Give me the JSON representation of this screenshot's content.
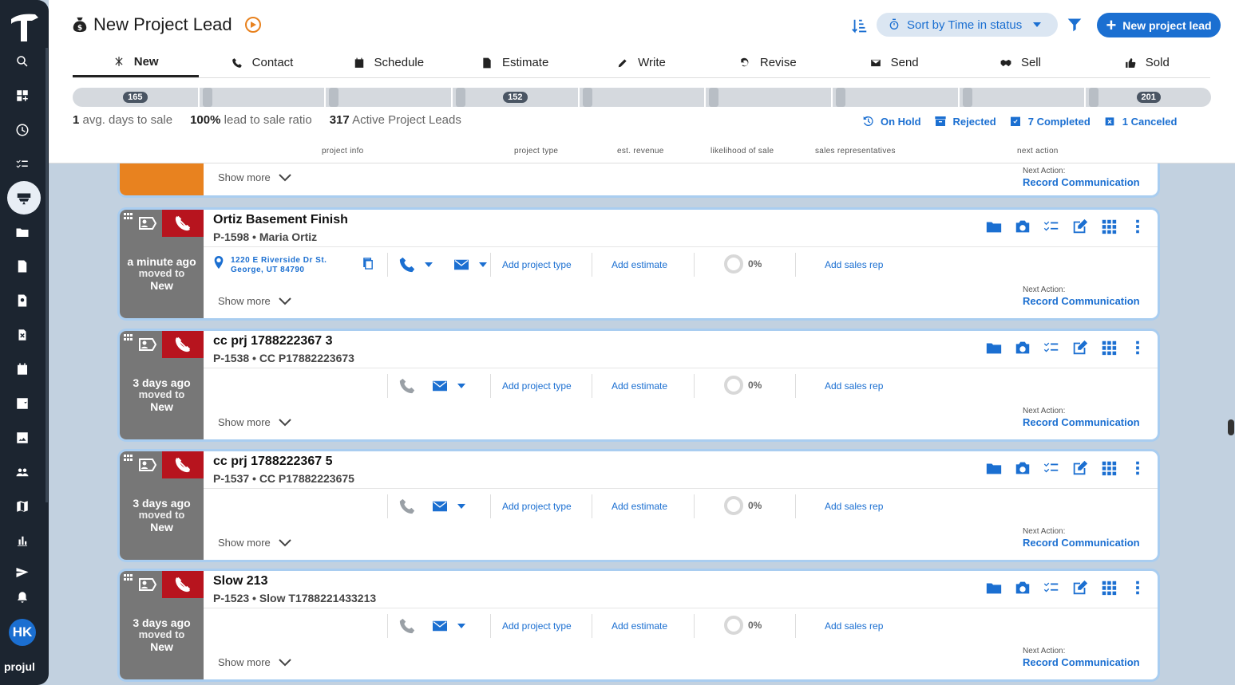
{
  "header": {
    "title": "New Project Lead",
    "sort_label": "Sort by Time in status",
    "new_button": "New project lead"
  },
  "tabs": [
    {
      "label": "New",
      "icon": "asterisk-icon"
    },
    {
      "label": "Contact",
      "icon": "phone-icon"
    },
    {
      "label": "Schedule",
      "icon": "calendar-icon"
    },
    {
      "label": "Estimate",
      "icon": "document-icon"
    },
    {
      "label": "Write",
      "icon": "pencil-icon"
    },
    {
      "label": "Revise",
      "icon": "undo-icon"
    },
    {
      "label": "Send",
      "icon": "envelope-icon"
    },
    {
      "label": "Sell",
      "icon": "handshake-icon"
    },
    {
      "label": "Sold",
      "icon": "thumbs-up-icon"
    }
  ],
  "progress_counts": [
    "165",
    "",
    "",
    "152",
    "",
    "",
    "",
    "",
    "201"
  ],
  "stats": {
    "days_value": "1",
    "days_label": "avg. days to sale",
    "ratio_value": "100%",
    "ratio_label": "lead to sale ratio",
    "active_value": "317",
    "active_label": "Active Project Leads"
  },
  "status_links": {
    "on_hold": "On Hold",
    "rejected": "Rejected",
    "completed": "7 Completed",
    "canceled": "1 Canceled"
  },
  "columns": {
    "project_info": "project info",
    "project_type": "project type",
    "est_revenue": "est. revenue",
    "likelihood": "likelihood of sale",
    "sales_reps": "sales representatives",
    "next_action": "next action"
  },
  "top_card": {
    "show_more": "Show more",
    "next_action_label": "Next Action:",
    "next_action": "Record Communication"
  },
  "cards": [
    {
      "name": "Ortiz Basement Finish",
      "sub": "P-1598 • Maria Ortiz",
      "time": "a minute ago",
      "moved": "moved to",
      "status": "New",
      "address_line1": "1220 E Riverside Dr St.",
      "address_line2": "George, UT 84790",
      "add_type": "Add project type",
      "add_estimate": "Add estimate",
      "pct": "0%",
      "add_rep": "Add sales rep",
      "show_more": "Show more",
      "next_action_label": "Next Action:",
      "next_action": "Record Communication"
    },
    {
      "name": "cc prj 1788222367 3",
      "sub": "P-1538 • CC P17882223673",
      "time": "3 days ago",
      "moved": "moved to",
      "status": "New",
      "add_type": "Add project type",
      "add_estimate": "Add estimate",
      "pct": "0%",
      "add_rep": "Add sales rep",
      "show_more": "Show more",
      "next_action_label": "Next Action:",
      "next_action": "Record Communication"
    },
    {
      "name": "cc prj 1788222367 5",
      "sub": "P-1537 • CC P17882223675",
      "time": "3 days ago",
      "moved": "moved to",
      "status": "New",
      "add_type": "Add project type",
      "add_estimate": "Add estimate",
      "pct": "0%",
      "add_rep": "Add sales rep",
      "show_more": "Show more",
      "next_action_label": "Next Action:",
      "next_action": "Record Communication"
    },
    {
      "name": "Slow 213",
      "sub": "P-1523 • Slow T1788221433213",
      "time": "3 days ago",
      "moved": "moved to",
      "status": "New",
      "add_type": "Add project type",
      "add_estimate": "Add estimate",
      "pct": "0%",
      "add_rep": "Add sales rep",
      "show_more": "Show more",
      "next_action_label": "Next Action:",
      "next_action": "Record Communication"
    }
  ],
  "user": {
    "initials": "HK"
  },
  "brand": "projul",
  "colors": {
    "accent": "#1b6fd1",
    "alert": "#b7141e",
    "orange": "#e8821f",
    "sidebar": "#1c2530"
  }
}
